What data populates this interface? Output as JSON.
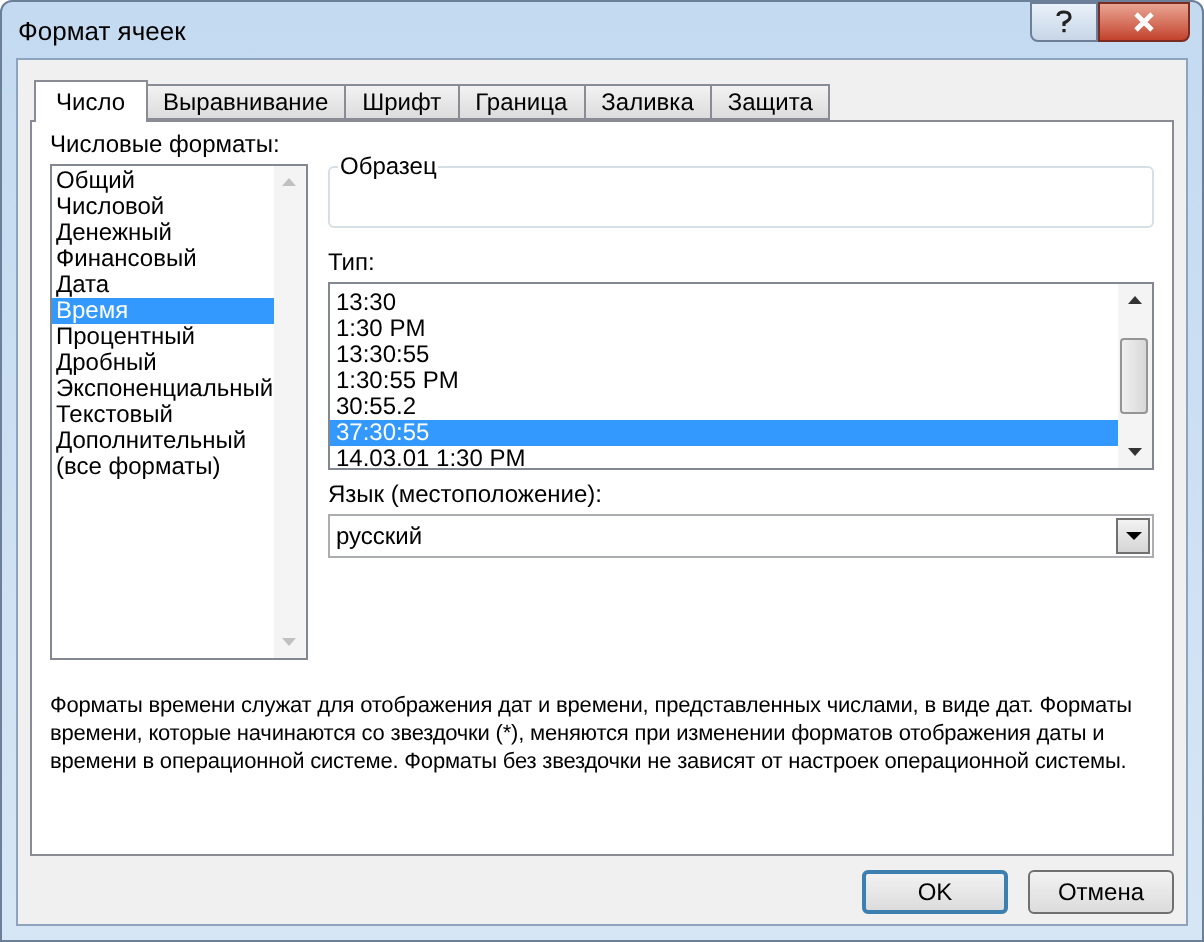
{
  "window": {
    "title": "Формат ячеек"
  },
  "tabs": [
    {
      "label": "Число",
      "selected": true
    },
    {
      "label": "Выравнивание",
      "selected": false
    },
    {
      "label": "Шрифт",
      "selected": false
    },
    {
      "label": "Граница",
      "selected": false
    },
    {
      "label": "Заливка",
      "selected": false
    },
    {
      "label": "Защита",
      "selected": false
    }
  ],
  "categories": {
    "label": "Числовые форматы:",
    "items": [
      {
        "label": "Общий",
        "selected": false
      },
      {
        "label": "Числовой",
        "selected": false
      },
      {
        "label": "Денежный",
        "selected": false
      },
      {
        "label": "Финансовый",
        "selected": false
      },
      {
        "label": "Дата",
        "selected": false
      },
      {
        "label": "Время",
        "selected": true
      },
      {
        "label": "Процентный",
        "selected": false
      },
      {
        "label": "Дробный",
        "selected": false
      },
      {
        "label": "Экспоненциальный",
        "selected": false
      },
      {
        "label": "Текстовый",
        "selected": false
      },
      {
        "label": "Дополнительный",
        "selected": false
      },
      {
        "label": "(все форматы)",
        "selected": false
      }
    ]
  },
  "sample": {
    "label": "Образец"
  },
  "types": {
    "label": "Тип:",
    "items": [
      {
        "label": "13:30",
        "selected": false
      },
      {
        "label": "1:30 PM",
        "selected": false
      },
      {
        "label": "13:30:55",
        "selected": false
      },
      {
        "label": "1:30:55 PM",
        "selected": false
      },
      {
        "label": "30:55.2",
        "selected": false
      },
      {
        "label": "37:30:55",
        "selected": true
      },
      {
        "label": "14.03.01 1:30 PM",
        "selected": false
      }
    ]
  },
  "locale": {
    "label": "Язык (местоположение):",
    "value": "русский"
  },
  "description": "Форматы времени служат для отображения дат и времени, представленных числами, в виде дат. Форматы времени, которые начинаются со звездочки (*), меняются при изменении форматов отображения даты и времени в операционной системе. Форматы без звездочки не зависят от настроек операционной системы.",
  "buttons": [
    {
      "label": "OK",
      "default": true
    },
    {
      "label": "Отмена",
      "default": false
    }
  ]
}
